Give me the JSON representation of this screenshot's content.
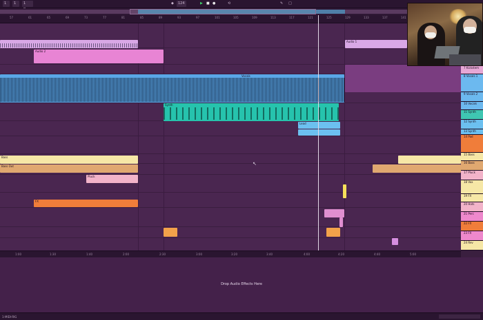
{
  "toolbar": {
    "items": [
      "1 Bar",
      "124",
      "1",
      "1"
    ],
    "colors": {
      "play": "#3fd46b"
    }
  },
  "ruler_ticks": [
    "57",
    "61",
    "65",
    "69",
    "73",
    "77",
    "81",
    "85",
    "89",
    "93",
    "97",
    "101",
    "105",
    "109",
    "113",
    "117",
    "121",
    "125",
    "129",
    "133",
    "137",
    "141",
    "145",
    "149"
  ],
  "clips": [
    {
      "lane": "Audio",
      "label": "Audio 1",
      "color": "#cf9ede"
    },
    {
      "lane": "Audio",
      "label": "Audio 2",
      "color": "#e07ad2"
    },
    {
      "lane": "Vocals",
      "label": "Vocals",
      "color": "#5aa6e6"
    },
    {
      "lane": "Synth",
      "label": "Synth",
      "color": "#26c3ad"
    },
    {
      "lane": "Lead",
      "label": "Lead",
      "color": "#6cc0f0"
    },
    {
      "lane": "Bass",
      "label": "Bass",
      "color": "#f6e7a6"
    },
    {
      "lane": "Bass Out",
      "label": "Bass Out",
      "color": "#e0a870"
    },
    {
      "lane": "Pluck",
      "label": "Pluck",
      "color": "#f2b3c9"
    },
    {
      "lane": "FX",
      "label": "FX",
      "color": "#f07d3a"
    }
  ],
  "track_heads": [
    {
      "label": "7 Kickstem",
      "color": "#e6a7d5"
    },
    {
      "label": "8 Vocals 1",
      "color": "#6cb9ef"
    },
    {
      "label": "9 Vocals 2",
      "color": "#6cb9ef"
    },
    {
      "label": "10 Vocals",
      "color": "#6cb9ef"
    },
    {
      "label": "11 Synth",
      "color": "#3fc6b2"
    },
    {
      "label": "12 Synth",
      "color": "#6cc0f0"
    },
    {
      "label": "13 Synth",
      "color": "#6cc0f0"
    },
    {
      "label": "14 Pad",
      "color": "#f07d3a"
    },
    {
      "label": "15 Bass",
      "color": "#f6e7a6"
    },
    {
      "label": "16 Bass",
      "color": "#e0a870"
    },
    {
      "label": "17 Pluck",
      "color": "#f2b3c9"
    },
    {
      "label": "18 Vox",
      "color": "#f6e7a6"
    },
    {
      "label": "19 FX",
      "color": "#f6e7a6"
    },
    {
      "label": "20 Hats",
      "color": "#f2b3c9"
    },
    {
      "label": "21 Perc",
      "color": "#ee88cc"
    },
    {
      "label": "22 FX",
      "color": "#f07d3a"
    },
    {
      "label": "23 FX",
      "color": "#ee88cc"
    },
    {
      "label": "24 Rev",
      "color": "#f6e7a6"
    }
  ],
  "bottom_ticks": [
    "1:00",
    "1:30",
    "1:40",
    "2:00",
    "2:30",
    "3:00",
    "3:20",
    "3:40",
    "4:00",
    "4:20",
    "4:40",
    "5:00"
  ],
  "fx_drop_message": "Drop Audio Effects Here",
  "status_text": "1-MIDI-RIG"
}
